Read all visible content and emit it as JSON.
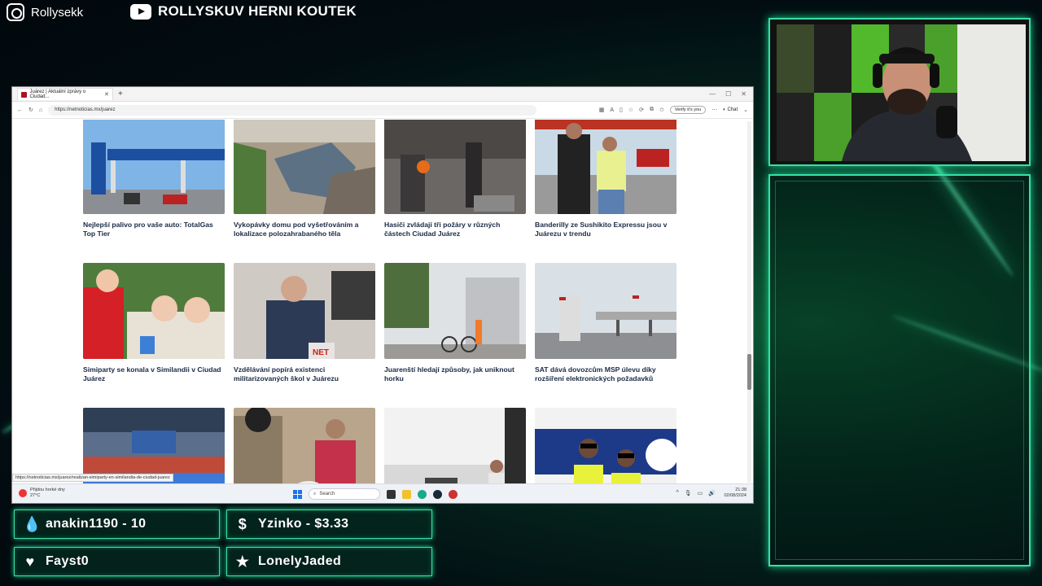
{
  "overlay": {
    "instagram_handle": "Rollysekk",
    "youtube_channel": "ROLLYSKUV HERNI KOUTEK"
  },
  "browser": {
    "tab_title": "Juárez | Aktuální zprávy o Ciudad...",
    "url": "https://netnoticias.mx/juarez",
    "verify_label": "Verify it's you",
    "chat_label": "Chat",
    "status_url": "https://netnoticias.mx/juarez/realizan-simiparty-en-similandia-de-ciudad-juarez"
  },
  "articles": [
    {
      "caption": "Nejlepší palivo pro vaše auto: TotalGas Top Tier",
      "thumb": "gas-station"
    },
    {
      "caption": "Vykopávky domu pod vyšetřováním a lokalizace polozahrabaného těla",
      "thumb": "rubble"
    },
    {
      "caption": "Hasiči zvládají tři požáry v různých částech Ciudad Juárez",
      "thumb": "fire"
    },
    {
      "caption": "Banderilly ze Sushikito Expressu jsou v Juárezu v trendu",
      "thumb": "couple"
    },
    {
      "caption": "Simiparty se konala v Similandii v Ciudad Juárez",
      "thumb": "mascots"
    },
    {
      "caption": "Vzdělávání popírá existenci militarizovaných škol v Juárezu",
      "thumb": "interview"
    },
    {
      "caption": "Juarenští hledají způsoby, jak uniknout horku",
      "thumb": "street"
    },
    {
      "caption": "SAT dává dovozcům MSP úlevu díky rozšíření elektronických požadavků",
      "thumb": "customs"
    },
    {
      "caption": "",
      "thumb": "arena"
    },
    {
      "caption": "",
      "thumb": "market"
    },
    {
      "caption": "",
      "thumb": "conference"
    },
    {
      "caption": "",
      "thumb": "arrest"
    }
  ],
  "taskbar": {
    "weather_line1": "Přijdou horké dny",
    "weather_line2": "27°C",
    "search_placeholder": "Search",
    "time": "21:38",
    "date": "02/08/2024"
  },
  "alerts": [
    {
      "icon": "drop-icon",
      "glyph": "💧",
      "text": "anakin1190 - 10"
    },
    {
      "icon": "dollar-icon",
      "glyph": "$",
      "text": "Yzinko - $3.33"
    },
    {
      "icon": "heart-icon",
      "glyph": "♥",
      "text": "Fayst0"
    },
    {
      "icon": "star-icon",
      "glyph": "★",
      "text": "LonelyJaded"
    }
  ]
}
